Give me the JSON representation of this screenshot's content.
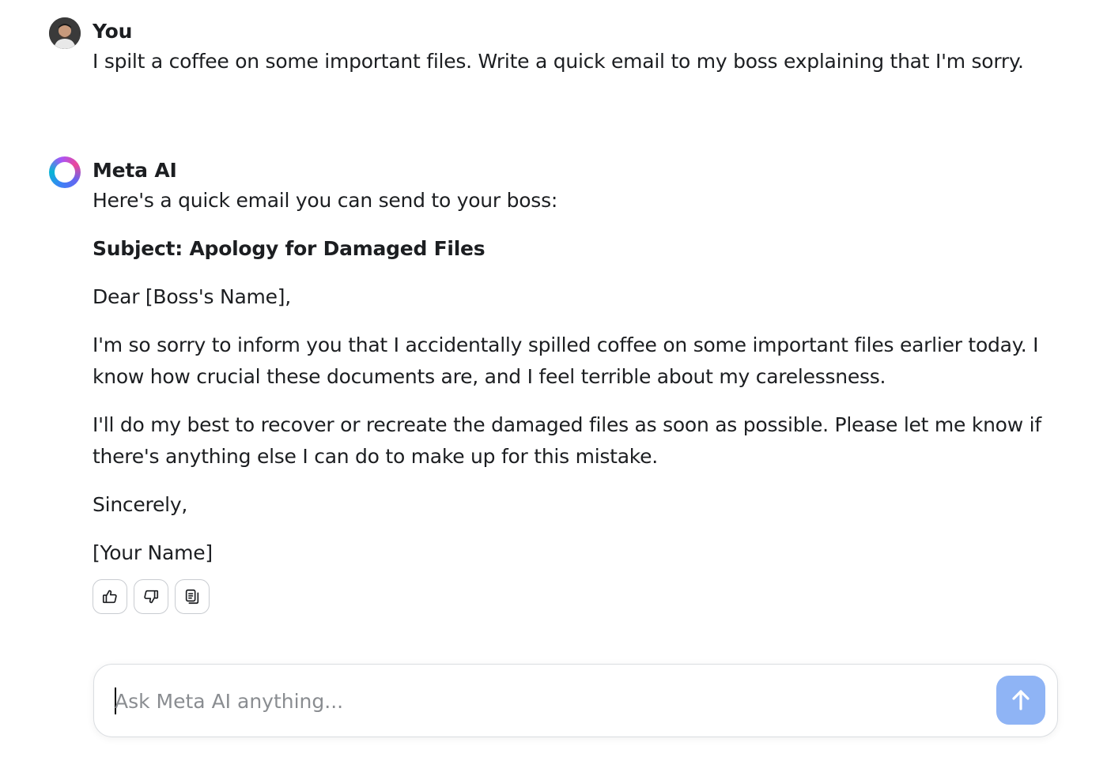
{
  "conversation": {
    "user_message": {
      "sender": "You",
      "text": "I spilt a coffee on some important files. Write a quick email to my boss explaining that I'm sorry."
    },
    "ai_message": {
      "sender": "Meta AI",
      "intro": "Here's a quick email you can send to your boss:",
      "subject": "Subject: Apology for Damaged Files",
      "greeting": "Dear [Boss's Name],",
      "paragraph_1": "I'm so sorry to inform you that I accidentally spilled coffee on some important files earlier today. I know how crucial these documents are, and I feel terrible about my carelessness.",
      "paragraph_2": "I'll do my best to recover or recreate the damaged files as soon as possible. Please let me know if there's anything else I can do to make up for this mistake.",
      "closing": "Sincerely,",
      "signature": "[Your Name]"
    },
    "actions": {
      "like_icon": "thumbs-up-icon",
      "dislike_icon": "thumbs-down-icon",
      "copy_icon": "copy-icon"
    }
  },
  "composer": {
    "placeholder": "Ask Meta AI anything...",
    "value": "",
    "send_icon": "arrow-up-icon",
    "send_color": "#8fb4f5"
  }
}
